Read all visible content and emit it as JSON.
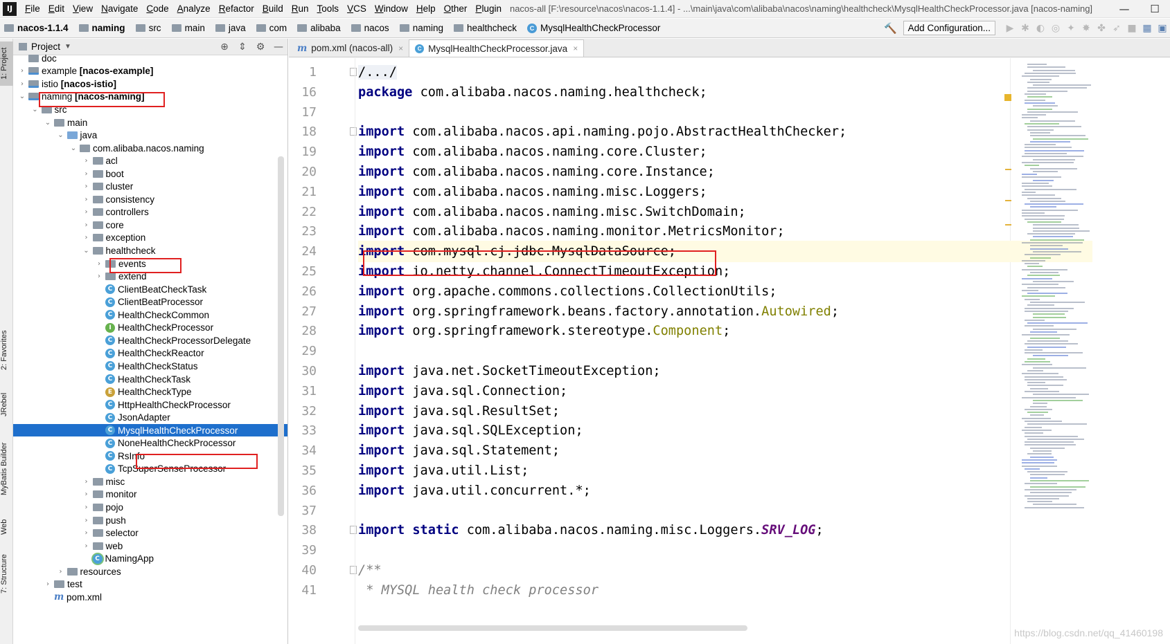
{
  "menubar": {
    "logo": "IJ",
    "items": [
      "File",
      "Edit",
      "View",
      "Navigate",
      "Code",
      "Analyze",
      "Refactor",
      "Build",
      "Run",
      "Tools",
      "VCS",
      "Window",
      "Help",
      "Other",
      "Plugin"
    ],
    "window_title": "nacos-all [F:\\resource\\nacos\\nacos-1.1.4] - ...\\main\\java\\com\\alibaba\\nacos\\naming\\healthcheck\\MysqlHealthCheckProcessor.java [nacos-naming]",
    "minimize": "—",
    "maximize": "☐"
  },
  "breadcrumbs": [
    "nacos-1.1.4",
    "naming",
    "src",
    "main",
    "java",
    "com",
    "alibaba",
    "nacos",
    "naming",
    "healthcheck",
    "MysqlHealthCheckProcessor"
  ],
  "toolbar": {
    "add_configuration": "Add Configuration..."
  },
  "left_strip": {
    "project": "1: Project",
    "favorites": "2: Favorites",
    "jrebel": "JRebel",
    "mybatis": "MyBatis Builder",
    "web": "Web",
    "structure": "7: Structure"
  },
  "project_panel": {
    "title": "Project",
    "rows": [
      {
        "text": "doc",
        "suffix": "",
        "indent": 1,
        "chev": "",
        "icon": "folder"
      },
      {
        "text": "example ",
        "suffix": "[nacos-example]",
        "indent": 1,
        "chev": "›",
        "icon": "module"
      },
      {
        "text": "istio ",
        "suffix": "[nacos-istio]",
        "indent": 1,
        "chev": "›",
        "icon": "module"
      },
      {
        "text": "naming ",
        "suffix": "[nacos-naming]",
        "indent": 1,
        "chev": "⌄",
        "icon": "module"
      },
      {
        "text": "src",
        "suffix": "",
        "indent": 2,
        "chev": "⌄",
        "icon": "folder"
      },
      {
        "text": "main",
        "suffix": "",
        "indent": 3,
        "chev": "⌄",
        "icon": "folder"
      },
      {
        "text": "java",
        "suffix": "",
        "indent": 4,
        "chev": "⌄",
        "icon": "src"
      },
      {
        "text": "com.alibaba.nacos.naming",
        "suffix": "",
        "indent": 5,
        "chev": "⌄",
        "icon": "folder"
      },
      {
        "text": "acl",
        "suffix": "",
        "indent": 6,
        "chev": "›",
        "icon": "folder"
      },
      {
        "text": "boot",
        "suffix": "",
        "indent": 6,
        "chev": "›",
        "icon": "folder"
      },
      {
        "text": "cluster",
        "suffix": "",
        "indent": 6,
        "chev": "›",
        "icon": "folder"
      },
      {
        "text": "consistency",
        "suffix": "",
        "indent": 6,
        "chev": "›",
        "icon": "folder"
      },
      {
        "text": "controllers",
        "suffix": "",
        "indent": 6,
        "chev": "›",
        "icon": "folder"
      },
      {
        "text": "core",
        "suffix": "",
        "indent": 6,
        "chev": "›",
        "icon": "folder"
      },
      {
        "text": "exception",
        "suffix": "",
        "indent": 6,
        "chev": "›",
        "icon": "folder"
      },
      {
        "text": "healthcheck",
        "suffix": "",
        "indent": 6,
        "chev": "⌄",
        "icon": "folder"
      },
      {
        "text": "events",
        "suffix": "",
        "indent": 7,
        "chev": "›",
        "icon": "folder"
      },
      {
        "text": "extend",
        "suffix": "",
        "indent": 7,
        "chev": "›",
        "icon": "folder"
      },
      {
        "text": "ClientBeatCheckTask",
        "suffix": "",
        "indent": 7,
        "chev": "",
        "icon": "class"
      },
      {
        "text": "ClientBeatProcessor",
        "suffix": "",
        "indent": 7,
        "chev": "",
        "icon": "class"
      },
      {
        "text": "HealthCheckCommon",
        "suffix": "",
        "indent": 7,
        "chev": "",
        "icon": "class"
      },
      {
        "text": "HealthCheckProcessor",
        "suffix": "",
        "indent": 7,
        "chev": "",
        "icon": "iface"
      },
      {
        "text": "HealthCheckProcessorDelegate",
        "suffix": "",
        "indent": 7,
        "chev": "",
        "icon": "class"
      },
      {
        "text": "HealthCheckReactor",
        "suffix": "",
        "indent": 7,
        "chev": "",
        "icon": "class"
      },
      {
        "text": "HealthCheckStatus",
        "suffix": "",
        "indent": 7,
        "chev": "",
        "icon": "class"
      },
      {
        "text": "HealthCheckTask",
        "suffix": "",
        "indent": 7,
        "chev": "",
        "icon": "class"
      },
      {
        "text": "HealthCheckType",
        "suffix": "",
        "indent": 7,
        "chev": "",
        "icon": "enum"
      },
      {
        "text": "HttpHealthCheckProcessor",
        "suffix": "",
        "indent": 7,
        "chev": "",
        "icon": "class"
      },
      {
        "text": "JsonAdapter",
        "suffix": "",
        "indent": 7,
        "chev": "",
        "icon": "class"
      },
      {
        "text": "MysqlHealthCheckProcessor",
        "suffix": "",
        "indent": 7,
        "chev": "",
        "icon": "class",
        "selected": true
      },
      {
        "text": "NoneHealthCheckProcessor",
        "suffix": "",
        "indent": 7,
        "chev": "",
        "icon": "class"
      },
      {
        "text": "RsInfo",
        "suffix": "",
        "indent": 7,
        "chev": "",
        "icon": "class"
      },
      {
        "text": "TcpSuperSenseProcessor",
        "suffix": "",
        "indent": 7,
        "chev": "",
        "icon": "class"
      },
      {
        "text": "misc",
        "suffix": "",
        "indent": 6,
        "chev": "›",
        "icon": "folder"
      },
      {
        "text": "monitor",
        "suffix": "",
        "indent": 6,
        "chev": "›",
        "icon": "folder"
      },
      {
        "text": "pojo",
        "suffix": "",
        "indent": 6,
        "chev": "›",
        "icon": "folder"
      },
      {
        "text": "push",
        "suffix": "",
        "indent": 6,
        "chev": "›",
        "icon": "folder"
      },
      {
        "text": "selector",
        "suffix": "",
        "indent": 6,
        "chev": "›",
        "icon": "folder"
      },
      {
        "text": "web",
        "suffix": "",
        "indent": 6,
        "chev": "›",
        "icon": "folder"
      },
      {
        "text": "NamingApp",
        "suffix": "",
        "indent": 6,
        "chev": "",
        "icon": "main"
      },
      {
        "text": "resources",
        "suffix": "",
        "indent": 4,
        "chev": "›",
        "icon": "folder"
      },
      {
        "text": "test",
        "suffix": "",
        "indent": 3,
        "chev": "›",
        "icon": "folder"
      },
      {
        "text": "pom.xml",
        "suffix": "",
        "indent": 3,
        "chev": "",
        "icon": "maven"
      }
    ]
  },
  "editor": {
    "tabs": [
      {
        "label": "pom.xml (nacos-all)",
        "icon": "m",
        "active": false
      },
      {
        "label": "MysqlHealthCheckProcessor.java",
        "icon": "c",
        "active": true
      }
    ],
    "close": "×",
    "lines": [
      {
        "n": "1",
        "segs": [
          [
            "fold",
            "/.../"
          ]
        ]
      },
      {
        "n": "16",
        "segs": [
          [
            "kw",
            "package"
          ],
          [
            "t",
            " com.alibaba.nacos.naming.healthcheck;"
          ]
        ]
      },
      {
        "n": "17",
        "segs": []
      },
      {
        "n": "18",
        "segs": [
          [
            "kw",
            "import"
          ],
          [
            "t",
            " com.alibaba.nacos.api.naming.pojo.AbstractHealthChecker;"
          ]
        ]
      },
      {
        "n": "19",
        "segs": [
          [
            "kw",
            "import"
          ],
          [
            "t",
            " com.alibaba.nacos.naming.core.Cluster;"
          ]
        ]
      },
      {
        "n": "20",
        "segs": [
          [
            "kw",
            "import"
          ],
          [
            "t",
            " com.alibaba.nacos.naming.core.Instance;"
          ]
        ]
      },
      {
        "n": "21",
        "segs": [
          [
            "kw",
            "import"
          ],
          [
            "t",
            " com.alibaba.nacos.naming.misc.Loggers;"
          ]
        ]
      },
      {
        "n": "22",
        "segs": [
          [
            "kw",
            "import"
          ],
          [
            "t",
            " com.alibaba.nacos.naming.misc.SwitchDomain;"
          ]
        ]
      },
      {
        "n": "23",
        "segs": [
          [
            "kw",
            "import"
          ],
          [
            "t",
            " com.alibaba.nacos.naming.monitor.MetricsMonitor;"
          ]
        ]
      },
      {
        "n": "24",
        "segs": [
          [
            "kw",
            "import"
          ],
          [
            "t",
            " com.mysql.cj.jdbc.MysqlDataSource;"
          ]
        ],
        "hl": true
      },
      {
        "n": "25",
        "segs": [
          [
            "kw",
            "import"
          ],
          [
            "t",
            " io.netty.channel.ConnectTimeoutException;"
          ]
        ]
      },
      {
        "n": "26",
        "segs": [
          [
            "kw",
            "import"
          ],
          [
            "t",
            " org.apache.commons.collections.CollectionUtils;"
          ]
        ]
      },
      {
        "n": "27",
        "segs": [
          [
            "kw",
            "import"
          ],
          [
            "t",
            " org.springframework.beans.factory.annotation."
          ],
          [
            "ann",
            "Autowired"
          ],
          [
            "t",
            ";"
          ]
        ]
      },
      {
        "n": "28",
        "segs": [
          [
            "kw",
            "import"
          ],
          [
            "t",
            " org.springframework.stereotype."
          ],
          [
            "ann",
            "Component"
          ],
          [
            "t",
            ";"
          ]
        ]
      },
      {
        "n": "29",
        "segs": []
      },
      {
        "n": "30",
        "segs": [
          [
            "kw",
            "import"
          ],
          [
            "t",
            " java.net.SocketTimeoutException;"
          ]
        ]
      },
      {
        "n": "31",
        "segs": [
          [
            "kw",
            "import"
          ],
          [
            "t",
            " java.sql.Connection;"
          ]
        ]
      },
      {
        "n": "32",
        "segs": [
          [
            "kw",
            "import"
          ],
          [
            "t",
            " java.sql.ResultSet;"
          ]
        ]
      },
      {
        "n": "33",
        "segs": [
          [
            "kw",
            "import"
          ],
          [
            "t",
            " java.sql.SQLException;"
          ]
        ]
      },
      {
        "n": "34",
        "segs": [
          [
            "kw",
            "import"
          ],
          [
            "t",
            " java.sql.Statement;"
          ]
        ]
      },
      {
        "n": "35",
        "segs": [
          [
            "kw",
            "import"
          ],
          [
            "t",
            " java.util.List;"
          ]
        ]
      },
      {
        "n": "36",
        "segs": [
          [
            "kw",
            "import"
          ],
          [
            "t",
            " java.util.concurrent.*;"
          ]
        ]
      },
      {
        "n": "37",
        "segs": []
      },
      {
        "n": "38",
        "segs": [
          [
            "kw",
            "import static"
          ],
          [
            "t",
            " com.alibaba.nacos.naming.misc.Loggers."
          ],
          [
            "stat",
            "SRV_LOG"
          ],
          [
            "t",
            ";"
          ]
        ]
      },
      {
        "n": "39",
        "segs": []
      },
      {
        "n": "40",
        "segs": [
          [
            "cm",
            "/**"
          ]
        ]
      },
      {
        "n": "41",
        "segs": [
          [
            "cm",
            " * MYSQL health check processor"
          ]
        ]
      }
    ]
  },
  "watermark": "https://blog.csdn.net/qq_41460198"
}
